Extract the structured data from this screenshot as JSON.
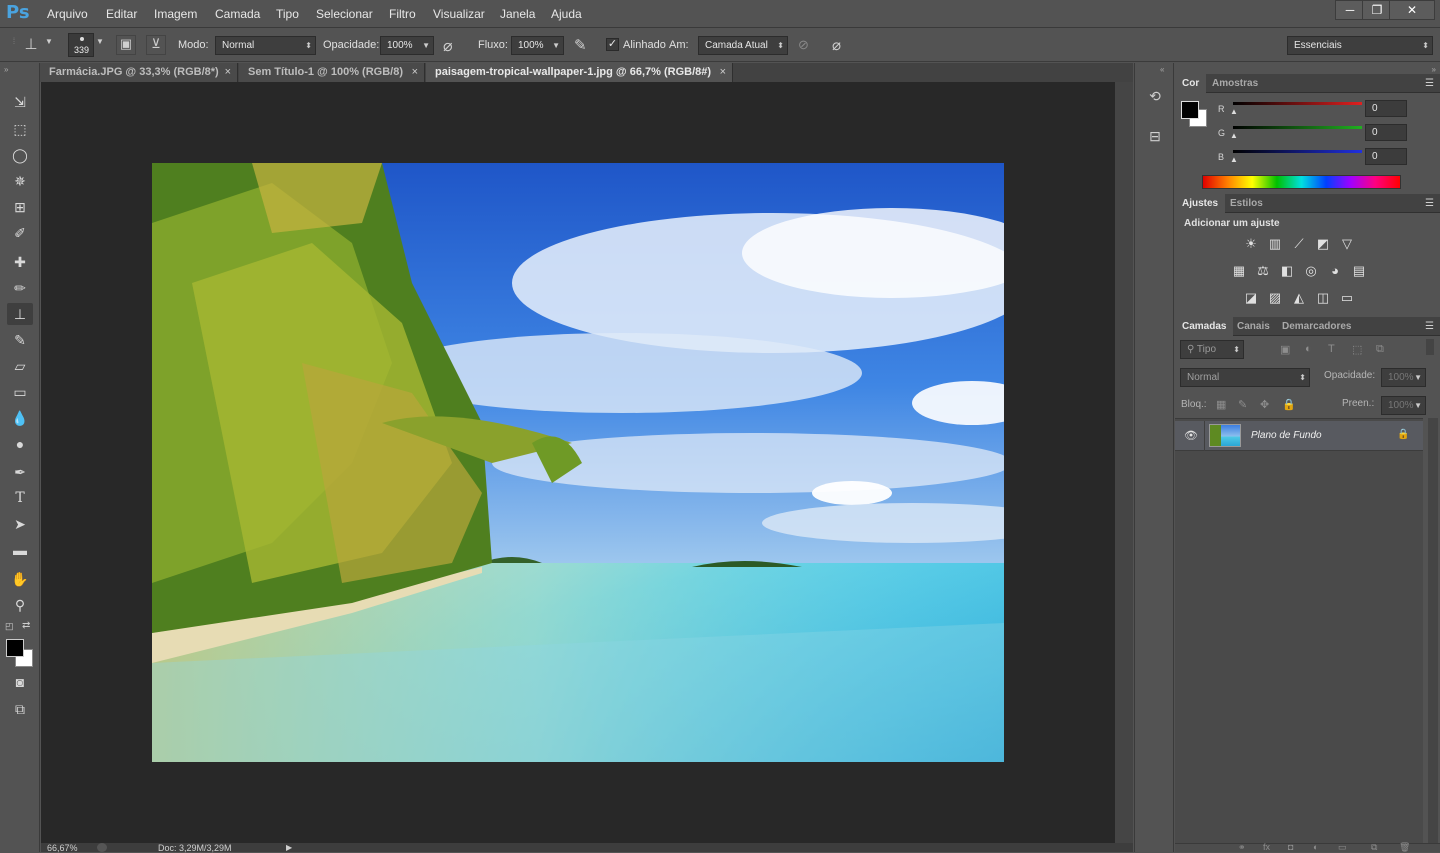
{
  "app": {
    "logo": "Ps"
  },
  "menu": [
    "Arquivo",
    "Editar",
    "Imagem",
    "Camada",
    "Tipo",
    "Selecionar",
    "Filtro",
    "Visualizar",
    "Janela",
    "Ajuda"
  ],
  "window_controls": {
    "minimize": "─",
    "restore": "❐",
    "close": "✕"
  },
  "options": {
    "brush_size": "339",
    "mode_label": "Modo:",
    "mode_value": "Normal",
    "opacity_label": "Opacidade:",
    "opacity_value": "100%",
    "flow_label": "Fluxo:",
    "flow_value": "100%",
    "aligned_label": "Alinhado",
    "aligned_checked": true,
    "sample_label": "Am:",
    "sample_value": "Camada Atual",
    "workspace": "Essenciais"
  },
  "tabs": [
    {
      "label": "Farmácia.JPG @ 33,3% (RGB/8*)",
      "close": "×"
    },
    {
      "label": "Sem Título-1 @ 100% (RGB/8)",
      "close": "×"
    },
    {
      "label": "paisagem-tropical-wallpaper-1.jpg @ 66,7% (RGB/8#)",
      "close": "×"
    }
  ],
  "status": {
    "zoom": "66,67%",
    "doc": "Doc: 3,29M/3,29M"
  },
  "color_panel": {
    "tabs": [
      "Cor",
      "Amostras"
    ],
    "r_label": "R",
    "g_label": "G",
    "b_label": "B",
    "r": "0",
    "g": "0",
    "b": "0",
    "r_color": "#e02020",
    "g_color": "#20b020",
    "b_color": "#2030e0"
  },
  "adjust_panel": {
    "tabs": [
      "Ajustes",
      "Estilos"
    ],
    "title": "Adicionar um ajuste",
    "row1": [
      "☀",
      "▥",
      "⟋",
      "◩",
      "▽"
    ],
    "row2": [
      "▦",
      "⚖",
      "◧",
      "◎",
      "◕",
      "▤"
    ],
    "row3": [
      "◪",
      "▨",
      "◭",
      "◫",
      "▭"
    ]
  },
  "layers_panel": {
    "tabs": [
      "Camadas",
      "Canais",
      "Demarcadores"
    ],
    "filter_label": "Tipo",
    "blend": "Normal",
    "opacity_label": "Opacidade:",
    "opacity_value": "100%",
    "lock_label": "Bloq.:",
    "fill_label": "Preen.:",
    "fill_value": "100%",
    "layer_name": "Plano de Fundo"
  }
}
